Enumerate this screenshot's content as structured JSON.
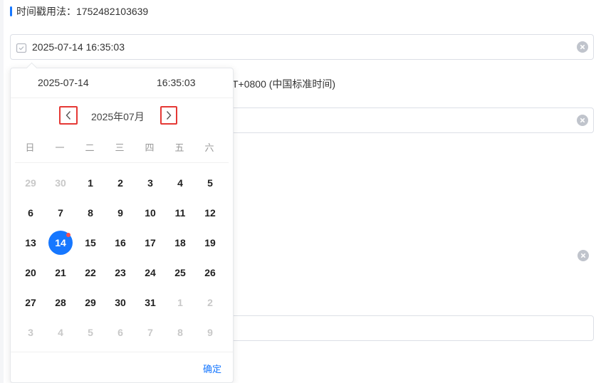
{
  "section": {
    "title": "时间戳用法：1752482103639"
  },
  "fields": {
    "main_value": "2025-07-14 16:35:03"
  },
  "hint": {
    "text": "T+0800 (中国标准时间)"
  },
  "picker": {
    "date_text": "2025-07-14",
    "time_text": "16:35:03",
    "month_label": "2025年07月",
    "weekdays": [
      "日",
      "一",
      "二",
      "三",
      "四",
      "五",
      "六"
    ],
    "days": [
      {
        "label": "29",
        "muted": true
      },
      {
        "label": "30",
        "muted": true
      },
      {
        "label": "1"
      },
      {
        "label": "2"
      },
      {
        "label": "3"
      },
      {
        "label": "4"
      },
      {
        "label": "5"
      },
      {
        "label": "6"
      },
      {
        "label": "7"
      },
      {
        "label": "8"
      },
      {
        "label": "9"
      },
      {
        "label": "10"
      },
      {
        "label": "11"
      },
      {
        "label": "12"
      },
      {
        "label": "13"
      },
      {
        "label": "14",
        "selected": true
      },
      {
        "label": "15"
      },
      {
        "label": "16"
      },
      {
        "label": "17"
      },
      {
        "label": "18"
      },
      {
        "label": "19"
      },
      {
        "label": "20"
      },
      {
        "label": "21"
      },
      {
        "label": "22"
      },
      {
        "label": "23"
      },
      {
        "label": "24"
      },
      {
        "label": "25"
      },
      {
        "label": "26"
      },
      {
        "label": "27"
      },
      {
        "label": "28"
      },
      {
        "label": "29"
      },
      {
        "label": "30"
      },
      {
        "label": "31"
      },
      {
        "label": "1",
        "muted": true
      },
      {
        "label": "2",
        "muted": true
      },
      {
        "label": "3",
        "muted": true
      },
      {
        "label": "4",
        "muted": true
      },
      {
        "label": "5",
        "muted": true
      },
      {
        "label": "6",
        "muted": true
      },
      {
        "label": "7",
        "muted": true
      },
      {
        "label": "8",
        "muted": true
      },
      {
        "label": "9",
        "muted": true
      }
    ],
    "confirm_label": "确定"
  },
  "icons": {
    "calendar": "calendar-icon",
    "clear": "clear-icon",
    "prev": "chevron-left-icon",
    "next": "chevron-right-icon"
  },
  "colors": {
    "accent": "#1677ff",
    "highlight_box": "#e53935",
    "badge_dot": "#ff4d4f"
  }
}
